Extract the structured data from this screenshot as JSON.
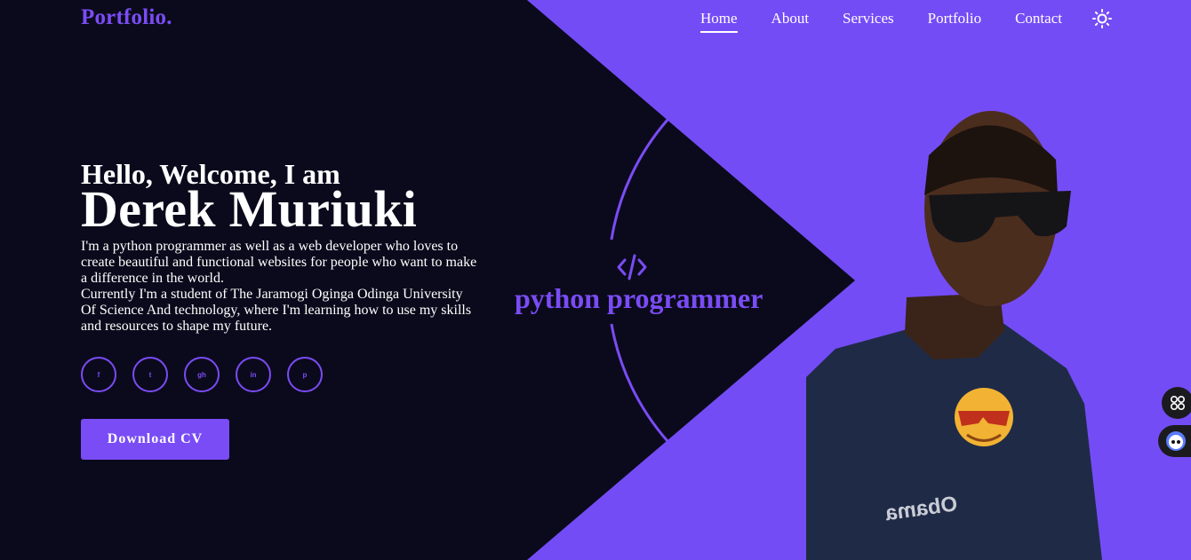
{
  "header": {
    "logo": "Portfolio.",
    "nav": [
      {
        "label": "Home",
        "active": true
      },
      {
        "label": "About",
        "active": false
      },
      {
        "label": "Services",
        "active": false
      },
      {
        "label": "Portfolio",
        "active": false
      },
      {
        "label": "Contact",
        "active": false
      }
    ],
    "theme_toggle_icon": "sun-icon"
  },
  "hero": {
    "greeting": "Hello, Welcome, I am",
    "name": "Derek Muriuki",
    "bio_line1": "I'm a python programmer as well as a web developer who loves to create beautiful and functional websites for people who want to make a difference in the world.",
    "bio_line2": "Currently I'm a student of The Jaramogi Oginga Odinga University Of Science And technology, where I'm learning how to use my skills and resources to shape my future.",
    "socials": [
      {
        "icon": "facebook-icon",
        "glyph": "f"
      },
      {
        "icon": "twitter-icon",
        "glyph": "t"
      },
      {
        "icon": "github-icon",
        "glyph": "gh"
      },
      {
        "icon": "linkedin-icon",
        "glyph": "in"
      },
      {
        "icon": "pinterest-icon",
        "glyph": "p"
      }
    ],
    "cta": "Download CV",
    "role_icon": "code-icon",
    "role": "python programmer",
    "shirt_text": "Obama"
  },
  "colors": {
    "accent": "#7a4cf5",
    "background": "#0b0a1c",
    "panel": "#744cf6",
    "text": "#ffffff"
  }
}
